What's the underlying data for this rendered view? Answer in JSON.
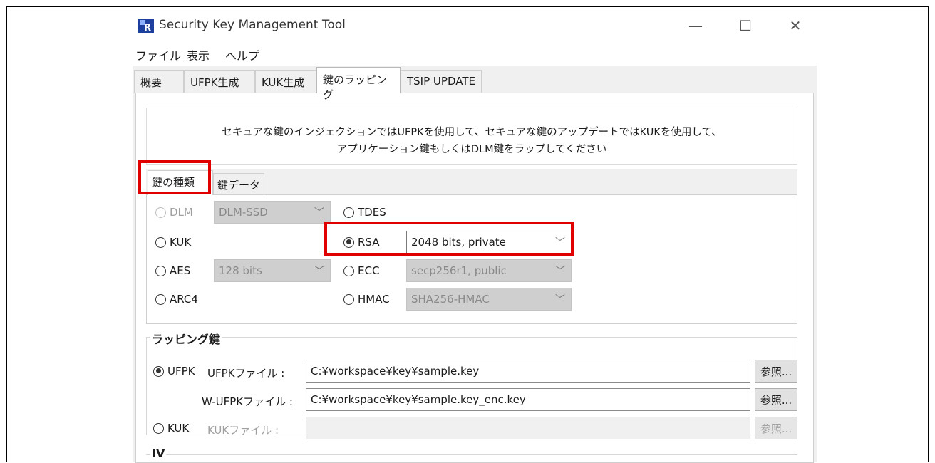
{
  "window": {
    "title": "Security Key Management Tool",
    "minimize": "—",
    "maximize": "☐",
    "close": "✕"
  },
  "menu": [
    "ファイル",
    "表示",
    "ヘルプ"
  ],
  "tabs": [
    "概要",
    "UFPK生成",
    "KUK生成",
    "鍵のラッピング",
    "TSIP UPDATE"
  ],
  "info": {
    "line1": "セキュアな鍵のインジェクションではUFPKを使用して、セキュアな鍵のアップデートではKUKを使用して、",
    "line2": "アプリケーション鍵もしくはDLM鍵をラップしてください"
  },
  "inner_tabs": [
    "鍵の種類",
    "鍵データ"
  ],
  "key_type": {
    "dlm": {
      "label": "DLM",
      "combo": "DLM-SSD"
    },
    "kuk": {
      "label": "KUK"
    },
    "aes": {
      "label": "AES",
      "combo": "128 bits"
    },
    "arc4": {
      "label": "ARC4"
    },
    "tdes": {
      "label": "TDES"
    },
    "rsa": {
      "label": "RSA",
      "combo": "2048 bits, private"
    },
    "ecc": {
      "label": "ECC",
      "combo": "secp256r1, public"
    },
    "hmac": {
      "label": "HMAC",
      "combo": "SHA256-HMAC"
    },
    "chevron": "﹀"
  },
  "wrapping": {
    "title": "ラッピング鍵",
    "ufpk_radio": "UFPK",
    "ufpk_file_label": "UFPKファイル :",
    "ufpk_file_value": "C:¥workspace¥key¥sample.key",
    "wufpk_file_label": "W-UFPKファイル :",
    "wufpk_file_value": "C:¥workspace¥key¥sample.key_enc.key",
    "kuk_radio": "KUK",
    "kuk_file_label": "KUKファイル :",
    "kuk_file_value": "",
    "browse": "参照..."
  },
  "iv": {
    "title": "IV"
  },
  "colors": {
    "highlight": "#e00000"
  }
}
